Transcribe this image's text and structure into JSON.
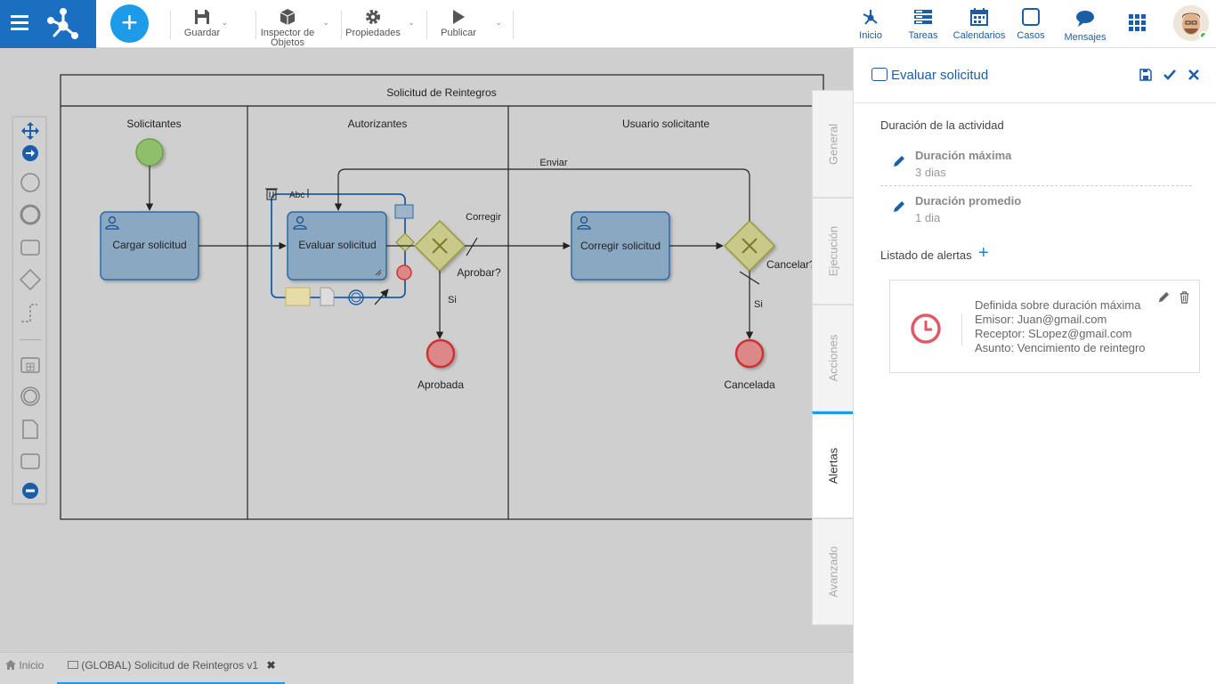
{
  "toolbar": {
    "save_label": "Guardar",
    "inspector_label": "Inspector de Objetos",
    "properties_label": "Propiedades",
    "publish_label": "Publicar"
  },
  "nav": {
    "home_label": "Inicio",
    "tasks_label": "Tareas",
    "calendars_label": "Calendarios",
    "cases_label": "Casos",
    "messages_label": "Mensajes"
  },
  "diagram": {
    "pool_title": "Solicitud de Reintegros",
    "lanes": [
      "Solicitantes",
      "Autorizantes",
      "Usuario solicitante"
    ],
    "tasks": {
      "cargar": "Cargar solicitud",
      "evaluar": "Evaluar solicitud",
      "corregir": "Corregir solicitud"
    },
    "labels": {
      "enviar": "Enviar",
      "corregir": "Corregir",
      "aprobar": "Aprobar?",
      "si1": "Si",
      "si2": "Si",
      "cancelar": "Cancelar?",
      "aprobada": "Aprobada",
      "cancelada": "Cancelada",
      "abc": "Abc"
    }
  },
  "side_tabs": [
    "General",
    "Ejecución",
    "Acciones",
    "Alertas",
    "Avanzado"
  ],
  "panel": {
    "title": "Evaluar solicitud",
    "duration_section": "Duración de la actividad",
    "max_label": "Duración máxima",
    "max_value": "3 dias",
    "avg_label": "Duración promedio",
    "avg_value": "1 dia",
    "alerts_section": "Listado de alertas",
    "alert": {
      "line1": "Definida sobre duración máxima",
      "line2": "Emisor: Juan@gmail.com",
      "line3": "Receptor: SLopez@gmail.com",
      "line4": "Asunto: Vencimiento de reintegro"
    }
  },
  "bottom_tabs": {
    "home": "Inicio",
    "document": "(GLOBAL) Solicitud de Reintegros v1"
  },
  "colors": {
    "brand": "#1a6fc0",
    "accent": "#1e9be8",
    "task_fill": "#8aa8c2",
    "task_border": "#2a6aa8",
    "gateway_fill": "#c9c98a",
    "end_event": "#d25a5a",
    "start_event": "#8fbf6a"
  }
}
